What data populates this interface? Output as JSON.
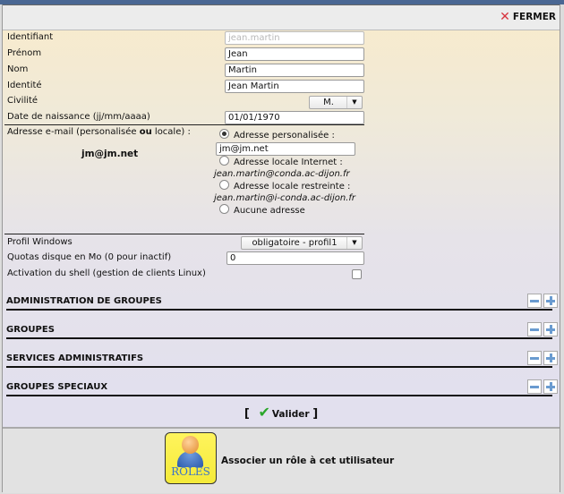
{
  "header": {
    "close_label": "FERMER",
    "close_icon": "close-x-icon"
  },
  "form": {
    "identifiant": {
      "label": "Identifiant",
      "value": "jean.martin",
      "disabled": true
    },
    "prenom": {
      "label": "Prénom",
      "value": "Jean"
    },
    "nom": {
      "label": "Nom",
      "value": "Martin"
    },
    "identite": {
      "label": "Identité",
      "value": "Jean Martin"
    },
    "civilite": {
      "label": "Civilité",
      "value": "M."
    },
    "naissance": {
      "label": "Date de naissance (jj/mm/aaaa)",
      "value": "01/01/1970"
    },
    "email": {
      "label_pre": "Adresse e-mail (personalisée ",
      "label_bold": "ou",
      "label_post": " locale) :",
      "current": "jm@jm.net",
      "options": [
        {
          "label": "Adresse personalisée :",
          "selected": true,
          "input_value": "jm@jm.net"
        },
        {
          "label": "Adresse locale Internet :",
          "selected": false,
          "address": "jean.martin@conda.ac-dijon.fr"
        },
        {
          "label": "Adresse locale restreinte :",
          "selected": false,
          "address": "jean.martin@i-conda.ac-dijon.fr"
        },
        {
          "label": "Aucune adresse",
          "selected": false
        }
      ]
    },
    "profil_windows": {
      "label": "Profil Windows",
      "value": "obligatoire - profil1"
    },
    "quotas": {
      "label": "Quotas disque en Mo (0 pour inactif)",
      "value": "0"
    },
    "shell": {
      "label": "Activation du shell (gestion de clients Linux)",
      "checked": false
    }
  },
  "sections": [
    {
      "title": "ADMINISTRATION DE GROUPES"
    },
    {
      "title": "GROUPES"
    },
    {
      "title": "SERVICES ADMINISTRATIFS"
    },
    {
      "title": "GROUPES SPECIAUX"
    }
  ],
  "validate": {
    "open": "[",
    "label": "Valider",
    "close": "]"
  },
  "roles": {
    "icon_label": "RÔLES",
    "text": "Associer un rôle à cet utilisateur"
  }
}
